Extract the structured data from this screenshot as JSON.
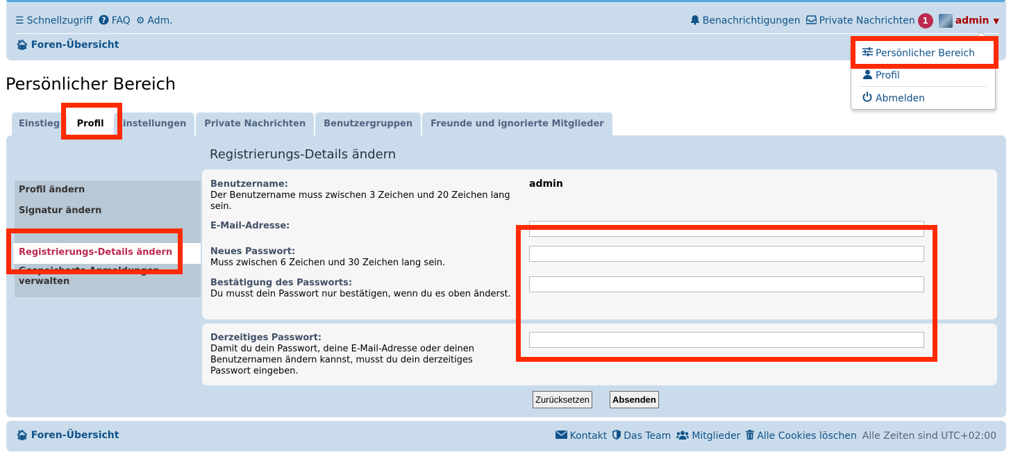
{
  "nav": {
    "quick_access": "Schnellzugriff",
    "faq": "FAQ",
    "admin_cp": "Adm.",
    "notifications": "Benachrichtigungen",
    "private_messages": "Private Nachrichten",
    "pm_count": "1",
    "username": "admin"
  },
  "breadcrumb": "Foren-Übersicht",
  "dropdown": {
    "items": [
      "Persönlicher Bereich",
      "Profil",
      "Abmelden"
    ]
  },
  "page_title": "Persönlicher Bereich",
  "tabs": [
    "Einstieg",
    "Profil",
    "Einstellungen",
    "Private Nachrichten",
    "Benutzergruppen",
    "Freunde und ignorierte Mitglieder"
  ],
  "active_tab": "Profil",
  "side_menu": {
    "items": [
      "Profil ändern",
      "Signatur ändern",
      "Registrierungs-Details ändern",
      "Gespeicherte Anmeldungen verwalten"
    ],
    "active": "Registrierungs-Details ändern"
  },
  "form": {
    "title": "Registrierungs-Details ändern",
    "username_label": "Benutzername:",
    "username_hint": "Der Benutzername muss zwischen 3 Zeichen und 20 Zeichen lang sein.",
    "username_value": "admin",
    "email_label": "E-Mail-Adresse:",
    "new_pw_label": "Neues Passwort:",
    "new_pw_hint": "Muss zwischen 6 Zeichen und 30 Zeichen lang sein.",
    "confirm_pw_label": "Bestätigung des Passworts:",
    "confirm_pw_hint": "Du musst dein Passwort nur bestätigen, wenn du es oben änderst.",
    "current_pw_label": "Derzeitiges Passwort:",
    "current_pw_hint": "Damit du dein Passwort, deine E-Mail-Adresse oder deinen Benutzernamen ändern kannst, musst du dein derzeitiges Passwort eingeben.",
    "reset_label": "Zurücksetzen",
    "submit_label": "Absenden"
  },
  "footer": {
    "breadcrumb": "Foren-Übersicht",
    "contact": "Kontakt",
    "team": "Das Team",
    "members": "Mitglieder",
    "delete_cookies": "Alle Cookies löschen",
    "timezone": "Alle Zeiten sind UTC+02:00"
  },
  "colors": {
    "highlight": "#ff2a00",
    "bar": "#cadceb",
    "link": "#105289",
    "active_menu": "#bc2a4d"
  }
}
